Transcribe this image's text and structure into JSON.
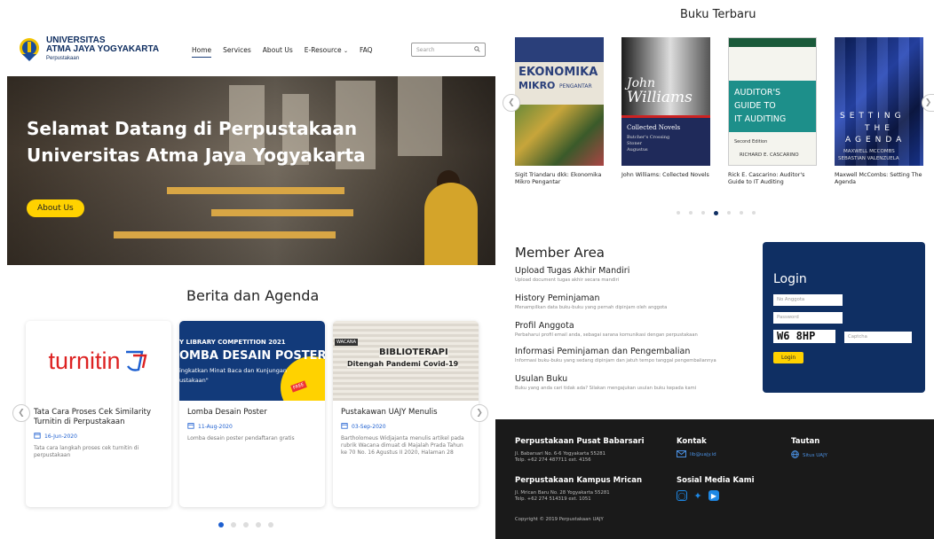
{
  "header": {
    "logo": {
      "line1": "UNIVERSITAS",
      "line2": "ATMA JAYA YOGYAKARTA",
      "line3": "Perpustakaan"
    },
    "nav": [
      "Home",
      "Services",
      "About Us",
      "E-Resource",
      "FAQ"
    ],
    "search_placeholder": "Search"
  },
  "hero": {
    "title": "Selamat Datang di Perpustakaan Universitas Atma Jaya Yogyakarta",
    "button": "About Us"
  },
  "berita": {
    "title": "Berita dan Agenda",
    "cards": [
      {
        "title": "Tata Cara Proses Cek Similarity Turnitin di Perpustakaan",
        "date": "16-Jun-2020",
        "summary": "Tata cara langkah proses cek turnitin di perpustakaan",
        "logo": "turnitin"
      },
      {
        "title": "Lomba Desain Poster",
        "date": "11-Aug-2020",
        "summary": "Lomba desain poster pendaftaran gratis",
        "img_l1": "Y LIBRARY COMPETITION 2021",
        "img_l2": "OMBA DESAIN POSTER",
        "img_l3": "ingkatkan Minat Baca dan Kunjungan",
        "img_l4": "ustakaan\"",
        "img_tag": "FREE"
      },
      {
        "title": "Pustakawan UAJY Menulis",
        "date": "03-Sep-2020",
        "summary": "Bartholomeus Widjajanta menulis artikel pada rubrik Wacana dimuat di Majalah Prada Tahun ke 70 No. 16 Agustus II 2020, Halaman 28",
        "img_l1": "BIBLIOTERAPI",
        "img_l2": "Ditengah Pandemi Covid-19",
        "img_tag": "WACANA"
      }
    ]
  },
  "buku": {
    "title": "Buku Terbaru",
    "books": [
      {
        "caption": "Sigit Triandaru dkk: Ekonomika Mikro Pengantar",
        "cover_l1": "EKONOMIKA",
        "cover_l2": "MIKRO",
        "cover_l3": "PENGANTAR"
      },
      {
        "caption": "John Williams: Collected Novels",
        "cover_l1": "John",
        "cover_l2": "Williams",
        "cover_l3": "Collected Novels",
        "cover_l4": "Butcher's Crossing",
        "cover_l5": "Stoner",
        "cover_l6": "Augustus"
      },
      {
        "caption": "Rick E. Cascarino: Auditor's Guide to IT Auditing",
        "cover_l1": "AUDITOR'S",
        "cover_l2": "GUIDE TO",
        "cover_l3": "IT AUDITING",
        "cover_l4": "Second Edition",
        "cover_l5": "RICHARD E. CASCARINO"
      },
      {
        "caption": "Maxwell McCombs: Setting The Agenda",
        "cover_l1": "SETTING",
        "cover_l2": "THE",
        "cover_l3": "AGENDA",
        "cover_l4": "MAXWELL MCCOMBS",
        "cover_l5": "SEBASTIAN VALENZUELA"
      }
    ]
  },
  "member": {
    "title": "Member Area",
    "items": [
      {
        "title": "Upload Tugas Akhir Mandiri",
        "desc": "Upload document tugas akhir secara mandiri"
      },
      {
        "title": "History Peminjaman",
        "desc": "Menampilkan data buku-buku yang pernah dipinjam oleh anggota"
      },
      {
        "title": "Profil Anggota",
        "desc": "Perbaharui profil email anda, sebagai sarana komunikasi dengan perpustakaan"
      },
      {
        "title": "Informasi Peminjaman dan Pengembalian",
        "desc": "Informasi buku-buku yang sedang dipinjam dan jatuh tempo tanggal pengembaliannya"
      },
      {
        "title": "Usulan Buku",
        "desc": "Buku yang anda cari tidak ada? Silakan mengajukan usulan buku kepada kami"
      }
    ]
  },
  "login": {
    "title": "Login",
    "no_anggota": "No Anggota",
    "password": "Password",
    "captcha_text": "W6 8HP",
    "captcha_placeholder": "Captcha",
    "button": "Login"
  },
  "footer": {
    "pusat_title": "Perpustakaan Pusat Babarsari",
    "pusat_addr": "Jl. Babarsari No. 6-6 Yogyakarta 55281",
    "pusat_telp": "Telp. +62 274 487711 ext. 4156",
    "mrican_title": "Perpustakaan Kampus Mrican",
    "mrican_addr": "Jl. Mrican Baru No. 28 Yogyakarta 55281",
    "mrican_telp": "Telp. +62 274 514319 ext. 1051",
    "kontak_title": "Kontak",
    "kontak_email": "lib@uajy.id",
    "tautan_title": "Tautan",
    "tautan_link": "Situs UAJY",
    "sosmed_title": "Sosial Media Kami",
    "copyright": "Copyright © 2019 Perpustakaan UAJY"
  },
  "colors": {
    "navy": "#0f2f63",
    "yellow": "#ffd200",
    "accent": "#1d5fd0",
    "footer_bg": "#1a1a1a"
  }
}
